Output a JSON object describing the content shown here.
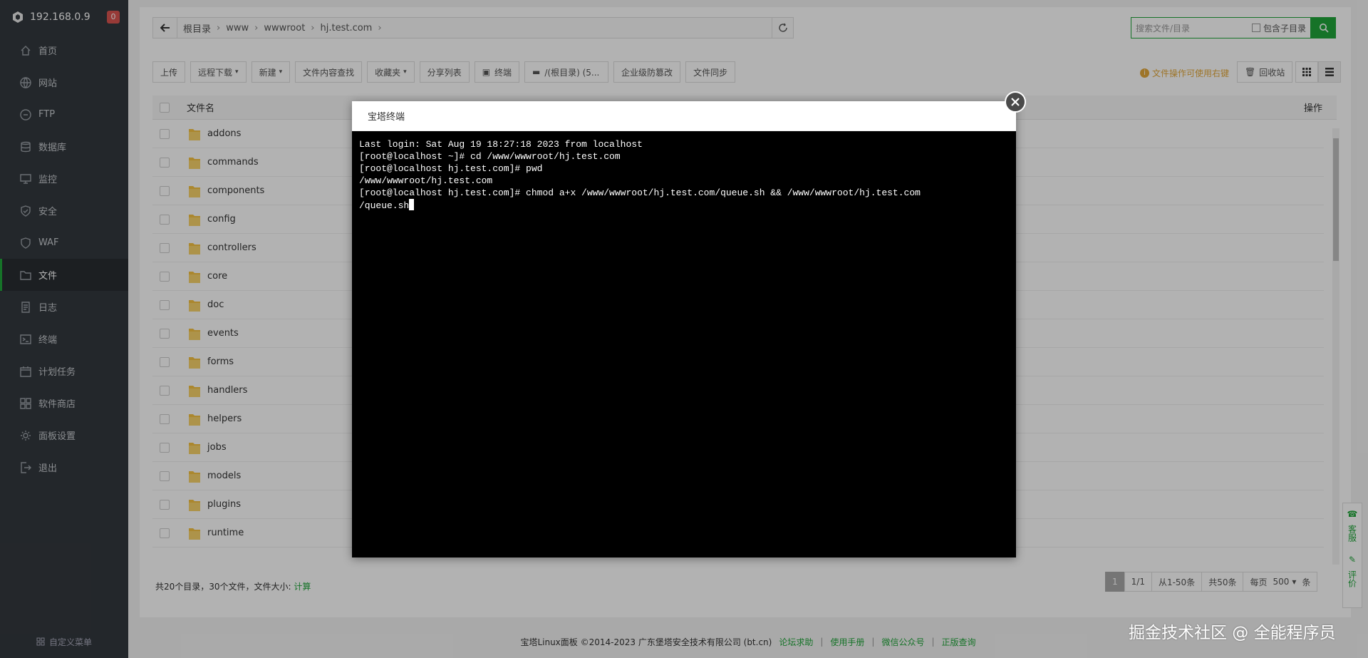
{
  "sidebar": {
    "ip": "192.168.0.9",
    "badge": "0",
    "items": [
      {
        "label": "首页",
        "icon": "home-icon"
      },
      {
        "label": "网站",
        "icon": "globe-icon"
      },
      {
        "label": "FTP",
        "icon": "ftp-icon"
      },
      {
        "label": "数据库",
        "icon": "database-icon"
      },
      {
        "label": "监控",
        "icon": "monitor-icon"
      },
      {
        "label": "安全",
        "icon": "shield-icon"
      },
      {
        "label": "WAF",
        "icon": "waf-shield-icon"
      },
      {
        "label": "文件",
        "icon": "folder-icon"
      },
      {
        "label": "日志",
        "icon": "log-icon"
      },
      {
        "label": "终端",
        "icon": "terminal-icon"
      },
      {
        "label": "计划任务",
        "icon": "calendar-icon"
      },
      {
        "label": "软件商店",
        "icon": "grid-icon"
      },
      {
        "label": "面板设置",
        "icon": "gear-icon"
      },
      {
        "label": "退出",
        "icon": "logout-icon"
      }
    ],
    "active_index": 7,
    "custom_menu": "自定义菜单"
  },
  "path": {
    "crumbs": [
      "根目录",
      "www",
      "wwwroot",
      "hj.test.com"
    ]
  },
  "search": {
    "placeholder": "搜索文件/目录",
    "include_sub": "包含子目录"
  },
  "toolbar": {
    "upload": "上传",
    "remote_download": "远程下载",
    "new": "新建",
    "content_search": "文件内容查找",
    "favorites": "收藏夹",
    "share_list": "分享列表",
    "terminal": "终端",
    "disk": "/(根目录) (5...",
    "tamper": "企业级防篡改",
    "sync": "文件同步",
    "tip": "文件操作可使用右键",
    "recycle": "回收站"
  },
  "table": {
    "col_name": "文件名",
    "col_op": "操作",
    "rows": [
      "addons",
      "commands",
      "components",
      "config",
      "controllers",
      "core",
      "doc",
      "events",
      "forms",
      "handlers",
      "helpers",
      "jobs",
      "models",
      "plugins",
      "runtime"
    ]
  },
  "summary": {
    "text": "共20个目录，30个文件，文件大小:",
    "calc": "计算"
  },
  "pager": {
    "current": "1",
    "pages": "1/1",
    "range": "从1-50条",
    "total": "共50条",
    "per_page_label": "每页",
    "per_page": "500",
    "unit": "条"
  },
  "side_float": {
    "service": "客服",
    "review": "评价"
  },
  "footer": {
    "copyright": "宝塔Linux面板 ©2014-2023 广东堡塔安全技术有限公司 (bt.cn)",
    "links": [
      "论坛求助",
      "使用手册",
      "微信公众号",
      "正版查询"
    ]
  },
  "modal": {
    "title": "宝塔终端",
    "lines": [
      "Last login: Sat Aug 19 18:27:18 2023 from localhost",
      "[root@localhost ~]# cd /www/wwwroot/hj.test.com",
      "[root@localhost hj.test.com]# pwd",
      "/www/wwwroot/hj.test.com",
      "[root@localhost hj.test.com]# chmod a+x /www/wwwroot/hj.test.com/queue.sh && /www/wwwroot/hj.test.com",
      "/queue.sh"
    ]
  },
  "watermark": "掘金技术社区 @ 全能程序员",
  "colors": {
    "accent": "#20a53a",
    "sidebar": "#33383e",
    "warning": "#e2a83c"
  }
}
